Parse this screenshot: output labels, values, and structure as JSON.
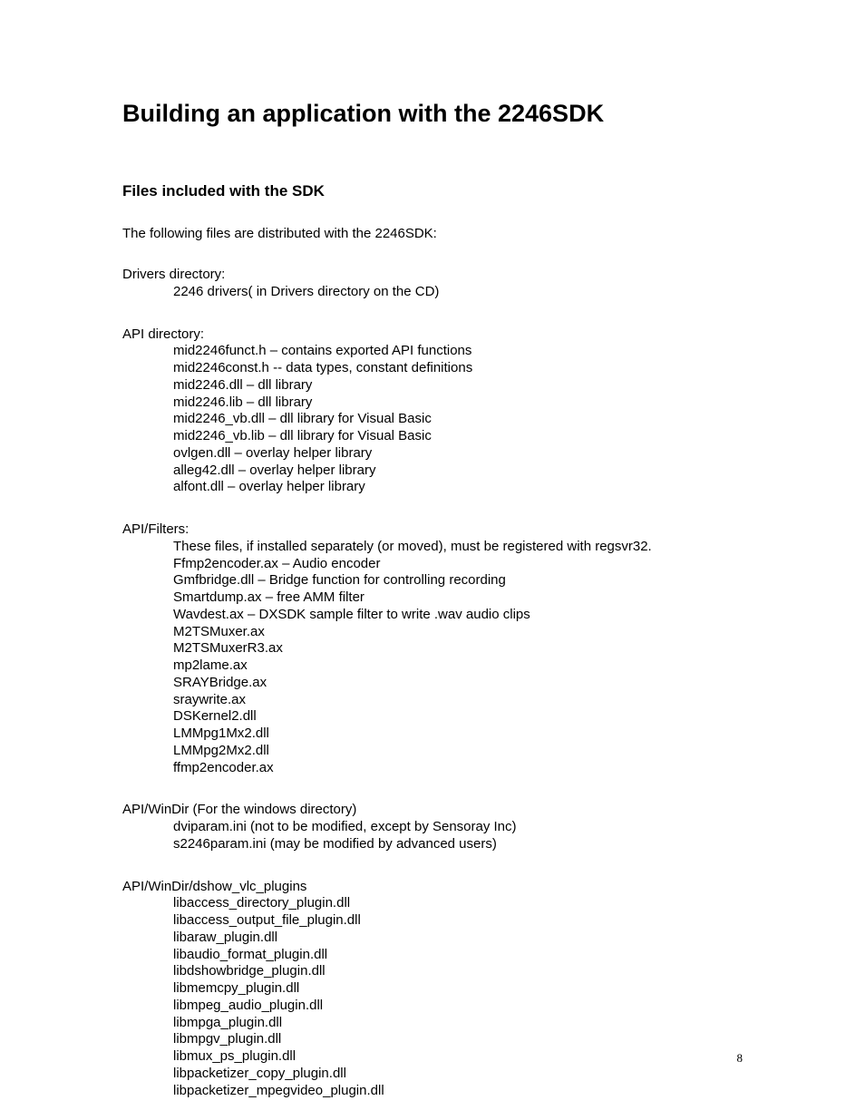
{
  "title": "Building an application with the 2246SDK",
  "subheading": "Files included with the SDK",
  "intro": "The following files are distributed with the 2246SDK:",
  "sections": [
    {
      "head": "Drivers directory:",
      "items": [
        "2246 drivers( in Drivers directory on the CD)"
      ]
    },
    {
      "head": "API directory:",
      "items": [
        "mid2246funct.h – contains exported API functions",
        "mid2246const.h -- data types, constant definitions",
        "mid2246.dll – dll library",
        "mid2246.lib – dll library",
        "mid2246_vb.dll – dll library for Visual Basic",
        "mid2246_vb.lib – dll library for Visual Basic",
        "ovlgen.dll – overlay helper library",
        "alleg42.dll – overlay helper library",
        "alfont.dll – overlay helper library"
      ]
    },
    {
      "head": "API/Filters:",
      "items": [
        "These files, if installed separately (or moved), must be registered with regsvr32.",
        "Ffmp2encoder.ax – Audio encoder",
        "Gmfbridge.dll – Bridge function for controlling recording",
        "Smartdump.ax – free AMM filter",
        "Wavdest.ax – DXSDK sample filter to write .wav audio clips",
        "M2TSMuxer.ax",
        "M2TSMuxerR3.ax",
        "mp2lame.ax",
        "SRAYBridge.ax",
        "sraywrite.ax",
        "DSKernel2.dll",
        "LMMpg1Mx2.dll",
        "LMMpg2Mx2.dll",
        "ffmp2encoder.ax"
      ]
    },
    {
      "head": "API/WinDir (For the windows directory)",
      "items": [
        "dviparam.ini (not to be modified, except by Sensoray Inc)",
        "s2246param.ini (may be modified by advanced users)"
      ]
    },
    {
      "head": "API/WinDir/dshow_vlc_plugins",
      "items": [
        "libaccess_directory_plugin.dll",
        "libaccess_output_file_plugin.dll",
        "libaraw_plugin.dll",
        "libaudio_format_plugin.dll",
        "libdshowbridge_plugin.dll",
        "libmemcpy_plugin.dll",
        "libmpeg_audio_plugin.dll",
        "libmpga_plugin.dll",
        "libmpgv_plugin.dll",
        "libmux_ps_plugin.dll",
        "libpacketizer_copy_plugin.dll",
        "libpacketizer_mpegvideo_plugin.dll"
      ]
    }
  ],
  "page_number": "8"
}
